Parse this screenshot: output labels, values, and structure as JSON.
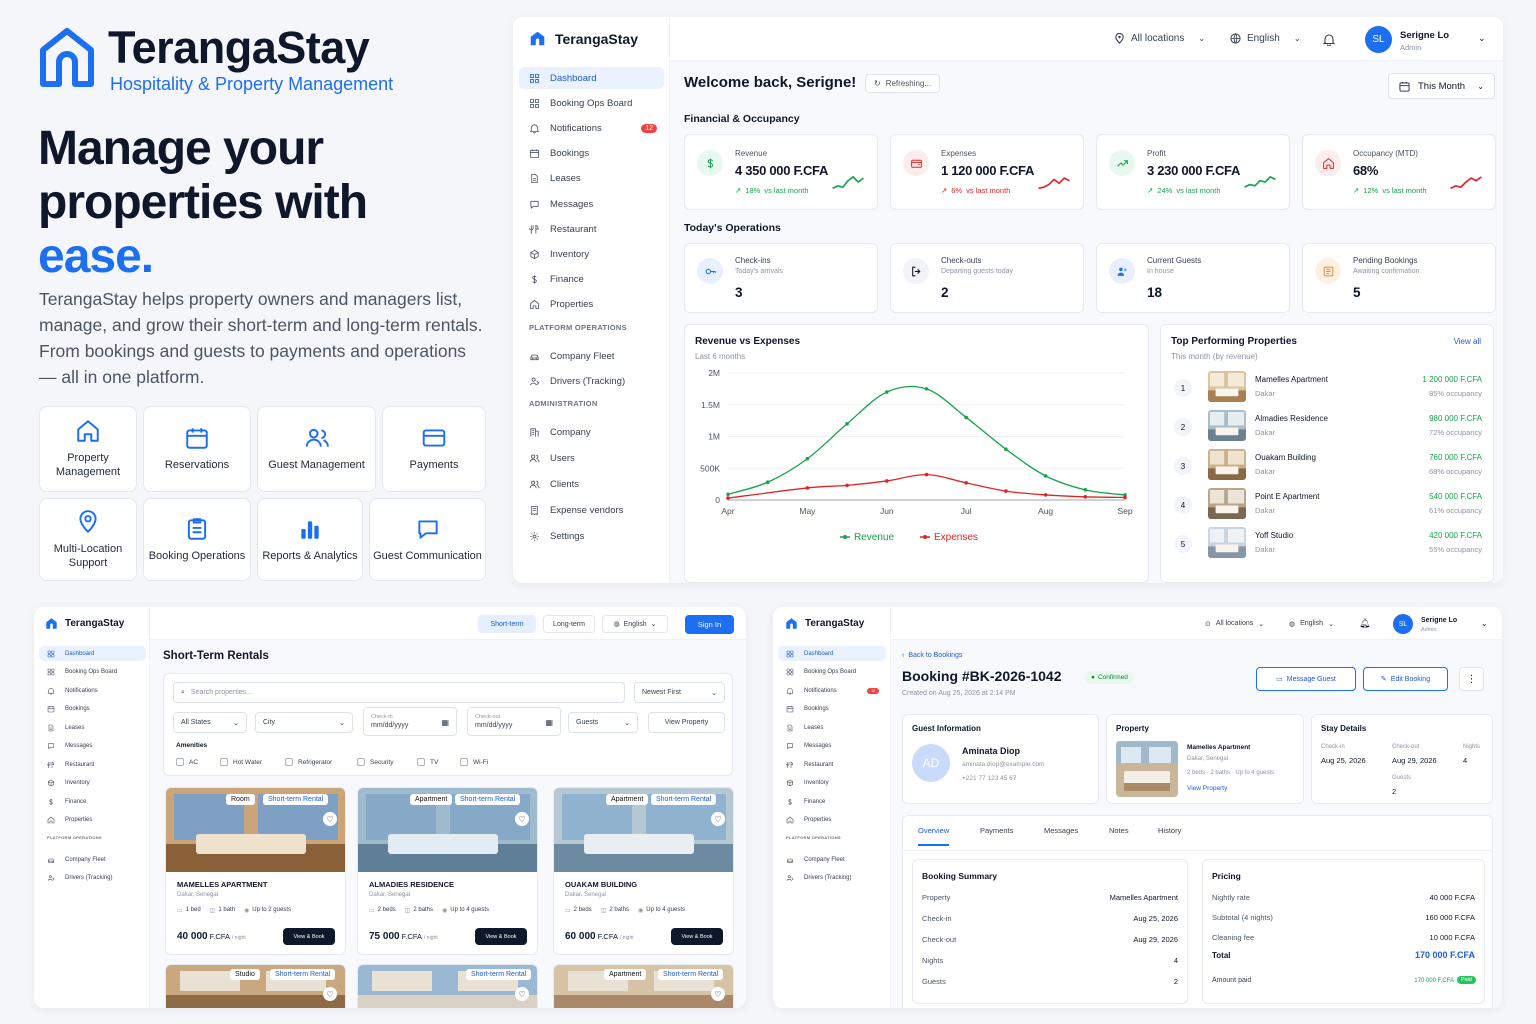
{
  "brand": {
    "name": "TerangaStay",
    "tagline": "Hospitality & Property Management"
  },
  "hero": {
    "line1": "Manage your",
    "line2": "properties with",
    "line3": "ease.",
    "description": "TerangaStay helps property owners and managers list, manage, and grow their short-term and long-term rentals. From bookings and guests to payments and operations — all in one platform."
  },
  "features": [
    {
      "label": "Property Management",
      "icon": "house-icon"
    },
    {
      "label": "Reservations",
      "icon": "calendar-icon"
    },
    {
      "label": "Guest Management",
      "icon": "users-icon"
    },
    {
      "label": "Payments",
      "icon": "card-icon"
    },
    {
      "label": "Multi-Location Support",
      "icon": "pin-icon"
    },
    {
      "label": "Booking Operations",
      "icon": "clipboard-icon"
    },
    {
      "label": "Reports & Analytics",
      "icon": "bar-chart-icon"
    },
    {
      "label": "Guest Communication",
      "icon": "chat-icon"
    }
  ],
  "topbar": {
    "locations": "All locations",
    "language": "English",
    "avatar_initials": "SL",
    "user_name": "Serigne Lo",
    "user_role": "Admin"
  },
  "sidebar": {
    "items": [
      "Dashboard",
      "Booking Ops Board",
      "Notifications",
      "Bookings",
      "Leases",
      "Messages",
      "Restaurant",
      "Inventory",
      "Finance",
      "Properties"
    ],
    "notifications_badge": "12",
    "platform_heading": "PLATFORM OPERATIONS",
    "platform_items": [
      "Company Fleet",
      "Drivers (Tracking)"
    ],
    "admin_heading": "ADMINISTRATION",
    "admin_items": [
      "Company",
      "Users",
      "Clients",
      "Expense vendors",
      "Settings"
    ]
  },
  "dashboard": {
    "welcome": "Welcome back, Serigne!",
    "refreshing": "Refreshing...",
    "period": "This Month",
    "financial_heading": "Financial & Occupancy",
    "kpis": [
      {
        "label": "Revenue",
        "value": "4 350 000 F.CFA",
        "delta": "18%",
        "delta_text": "vs last month",
        "trend": "up",
        "color": "#16a34a"
      },
      {
        "label": "Expenses",
        "value": "1 120 000 F.CFA",
        "delta": "6%",
        "delta_text": "vs last month",
        "trend": "up",
        "color": "#dc2626"
      },
      {
        "label": "Profit",
        "value": "3 230 000 F.CFA",
        "delta": "24%",
        "delta_text": "vs last month",
        "trend": "up",
        "color": "#16a34a"
      },
      {
        "label": "Occupancy (MTD)",
        "value": "68%",
        "delta": "12%",
        "delta_text": "vs last month",
        "trend": "up",
        "color": "#16a34a"
      }
    ],
    "ops_heading": "Today's Operations",
    "ops": [
      {
        "label": "Check-ins",
        "sub": "Today's arrivals",
        "value": "3"
      },
      {
        "label": "Check-outs",
        "sub": "Departing guests today",
        "value": "2"
      },
      {
        "label": "Current Guests",
        "sub": "In house",
        "value": "18"
      },
      {
        "label": "Pending Bookings",
        "sub": "Awaiting confirmation",
        "value": "5"
      }
    ],
    "top_heading": "Top Performing Properties",
    "top_sub": "This month (by revenue)",
    "view_all": "View all",
    "top": [
      {
        "rank": "1",
        "name": "Mamelles Apartment",
        "city": "Dakar",
        "revenue": "1 200 000 F.CFA",
        "occ": "85% occupancy"
      },
      {
        "rank": "2",
        "name": "Almadies Residence",
        "city": "Dakar",
        "revenue": "980 000 F.CFA",
        "occ": "72% occupancy"
      },
      {
        "rank": "3",
        "name": "Ouakam Building",
        "city": "Dakar",
        "revenue": "760 000 F.CFA",
        "occ": "68% occupancy"
      },
      {
        "rank": "4",
        "name": "Point E Apartment",
        "city": "Dakar",
        "revenue": "540 000 F.CFA",
        "occ": "61% occupancy"
      },
      {
        "rank": "5",
        "name": "Yoff Studio",
        "city": "Dakar",
        "revenue": "420 000 F.CFA",
        "occ": "55% occupancy"
      }
    ]
  },
  "chart_data": {
    "type": "line",
    "title": "Revenue vs Expenses",
    "subtitle": "Last 6 months",
    "x": [
      "Apr",
      "May",
      "Jun",
      "Jul",
      "Aug",
      "Sep"
    ],
    "y_ticks": [
      "0",
      "500K",
      "1M",
      "1.5M",
      "2M"
    ],
    "ylim": [
      0,
      2000000
    ],
    "grid": true,
    "legend_position": "bottom",
    "series": [
      {
        "name": "Revenue",
        "color": "#16a34a",
        "x": [
          0,
          0.5,
          1,
          1.5,
          2,
          2.5,
          3,
          3.5,
          4,
          4.5,
          5
        ],
        "values": [
          90000,
          280000,
          650000,
          1200000,
          1700000,
          1750000,
          1300000,
          800000,
          380000,
          160000,
          80000
        ]
      },
      {
        "name": "Expenses",
        "color": "#dc2626",
        "x": [
          0,
          1,
          1.5,
          2,
          2.5,
          3,
          3.5,
          4,
          4.5,
          5
        ],
        "values": [
          30000,
          190000,
          230000,
          300000,
          400000,
          270000,
          140000,
          80000,
          50000,
          40000
        ]
      }
    ]
  },
  "rentals": {
    "nav_short": "Short-term",
    "nav_long": "Long-term",
    "language": "English",
    "sign_in": "Sign In",
    "title": "Short-Term Rentals",
    "search_placeholder": "Search properties...",
    "sort": "Newest First",
    "states": "All States",
    "city": "City",
    "checkin_label": "Check-in",
    "checkout_label": "Check-out",
    "date_placeholder": "mm/dd/yyyy",
    "guests": "Guests",
    "view_property": "View Property",
    "amenities_heading": "Amenities",
    "amenities": [
      "AC",
      "Hot Water",
      "Refrigerator",
      "Security",
      "TV",
      "Wi-Fi"
    ],
    "per_night": "/ night",
    "book": "View & Book",
    "listings": [
      {
        "type": "Room",
        "rental": "Short-term Rental",
        "name": "MAMELLES APARTMENT",
        "location": "Dakar, Senegal",
        "beds": "1 bed",
        "baths": "1 bath",
        "guests": "Up to 2 guests",
        "price": "40 000",
        "currency": "F.CFA"
      },
      {
        "type": "Apartment",
        "rental": "Short-term Rental",
        "name": "ALMADIES RESIDENCE",
        "location": "Dakar, Senegal",
        "beds": "2 beds",
        "baths": "2 baths",
        "guests": "Up to 4 guests",
        "price": "75 000",
        "currency": "F.CFA"
      },
      {
        "type": "Apartment",
        "rental": "Short-term Rental",
        "name": "OUAKAM BUILDING",
        "location": "Dakar, Senegal",
        "beds": "2 beds",
        "baths": "2 baths",
        "guests": "Up to 4 guests",
        "price": "60 000",
        "currency": "F.CFA"
      }
    ],
    "more": [
      {
        "type": "Studio",
        "rental": "Short-term Rental"
      },
      {
        "type": "",
        "rental": "Short-term Rental"
      },
      {
        "type": "Apartment",
        "rental": "Short-term Rental"
      }
    ]
  },
  "booking": {
    "back": "Back to Bookings",
    "title": "Booking #BK-2026-1042",
    "status": "Confirmed",
    "created": "Created on Aug 25, 2026 at 2:14 PM",
    "message_guest": "Message Guest",
    "edit": "Edit Booking",
    "guest_heading": "Guest Information",
    "guest_initials": "AD",
    "guest_name": "Aminata Diop",
    "guest_email": "aminata.diop@example.com",
    "guest_phone": "+221 77 123 45 67",
    "property_heading": "Property",
    "property_name": "Mamelles Apartment",
    "property_location": "Dakar, Senegal",
    "property_meta": "2 beds · 2 baths · Up to 4 guests",
    "view_property": "View Property",
    "stay_heading": "Stay Details",
    "checkin_label": "Check-in",
    "checkin": "Aug 25, 2026",
    "checkout_label": "Check-out",
    "checkout": "Aug 29, 2026",
    "nights_label": "Nights",
    "nights": "4",
    "guests_label": "Guests",
    "guests": "2",
    "tabs": [
      "Overview",
      "Payments",
      "Messages",
      "Notes",
      "History"
    ],
    "summary_heading": "Booking Summary",
    "summary": [
      {
        "k": "Property",
        "v": "Mamelles Apartment"
      },
      {
        "k": "Check-in",
        "v": "Aug 25, 2026"
      },
      {
        "k": "Check-out",
        "v": "Aug 29, 2026"
      },
      {
        "k": "Nights",
        "v": "4"
      },
      {
        "k": "Guests",
        "v": "2"
      }
    ],
    "pricing_heading": "Pricing",
    "pricing": [
      {
        "k": "Nightly rate",
        "v": "40 000 F.CFA"
      },
      {
        "k": "Subtotal (4 nights)",
        "v": "160 000 F.CFA"
      },
      {
        "k": "Cleaning fee",
        "v": "10 000 F.CFA"
      }
    ],
    "total_label": "Total",
    "total": "170 000 F.CFA",
    "paid_label": "Amount paid",
    "paid": "170 000 F.CFA",
    "paid_badge": "Paid"
  }
}
